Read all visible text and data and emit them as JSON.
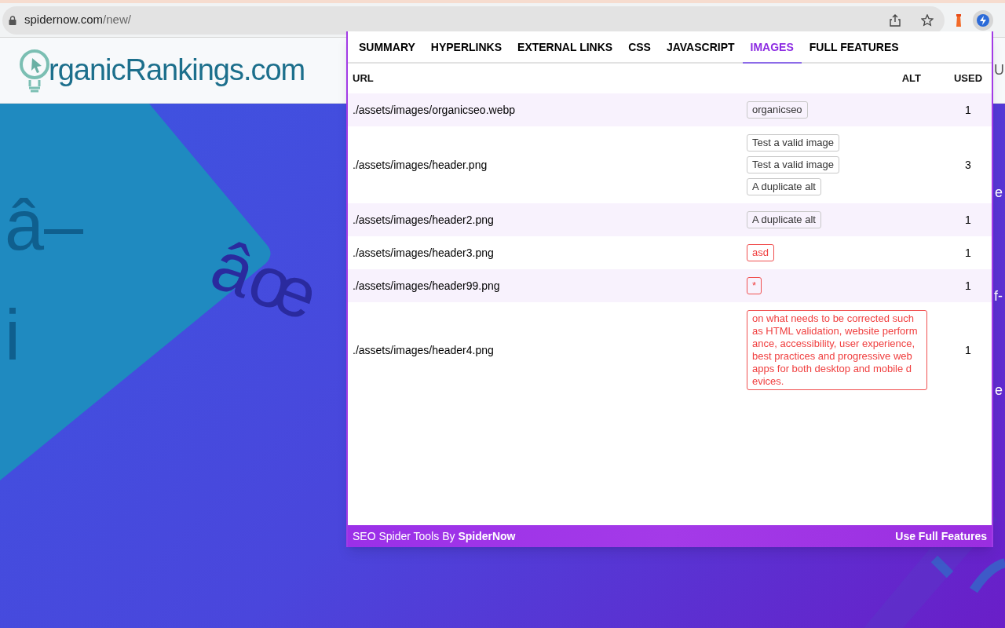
{
  "browser": {
    "url_host": "spidernow.com",
    "url_path": "/new/"
  },
  "page": {
    "logo_text": "rganicRankings.com",
    "background_glyphs": [
      "â–",
      "i",
      "âœ"
    ],
    "edge_fragments": [
      "U",
      "e",
      "f-",
      "e"
    ]
  },
  "popup": {
    "tabs": [
      {
        "label": "SUMMARY",
        "selected": false
      },
      {
        "label": "HYPERLINKS",
        "selected": false
      },
      {
        "label": "EXTERNAL LINKS",
        "selected": false
      },
      {
        "label": "CSS",
        "selected": false
      },
      {
        "label": "JAVASCRIPT",
        "selected": false
      },
      {
        "label": "IMAGES",
        "selected": true
      },
      {
        "label": "FULL FEATURES",
        "selected": false
      }
    ],
    "table": {
      "columns": [
        "URL",
        "ALT",
        "USED"
      ],
      "rows": [
        {
          "url": "./assets/images/organicseo.webp",
          "alts": [
            {
              "text": "organicseo",
              "kind": "ok"
            }
          ],
          "used": "1"
        },
        {
          "url": "./assets/images/header.png",
          "alts": [
            {
              "text": "Test a valid image",
              "kind": "ok"
            },
            {
              "text": "Test a valid image",
              "kind": "ok"
            },
            {
              "text": "A duplicate alt",
              "kind": "ok"
            }
          ],
          "used": "3"
        },
        {
          "url": "./assets/images/header2.png",
          "alts": [
            {
              "text": "A duplicate alt",
              "kind": "ok"
            }
          ],
          "used": "1"
        },
        {
          "url": "./assets/images/header3.png",
          "alts": [
            {
              "text": "asd",
              "kind": "error"
            }
          ],
          "used": "1"
        },
        {
          "url": "./assets/images/header99.png",
          "alts": [
            {
              "text": "*",
              "kind": "error"
            }
          ],
          "used": "1"
        },
        {
          "url": "./assets/images/header4.png",
          "alts": [
            {
              "text": "on what needs to be corrected such as HTML validation, website perform ance, accessibility, user experience, best practices and progressive web apps for both desktop and mobile d evices.",
              "kind": "error"
            }
          ],
          "used": "1"
        }
      ]
    },
    "footer": {
      "credit": "SEO Spider Tools By **SpiderNow**",
      "link": "Use Full Features"
    }
  }
}
